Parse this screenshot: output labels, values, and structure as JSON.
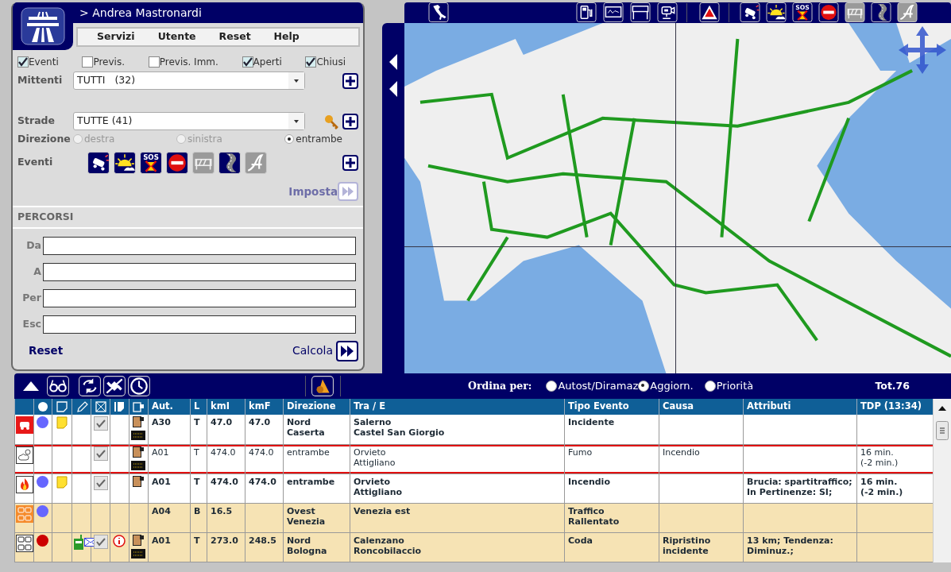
{
  "user": {
    "name": "> Andrea Mastronardi"
  },
  "menu": [
    "Servizi",
    "Utente",
    "Reset",
    "Help"
  ],
  "filters": [
    {
      "label": "Eventi",
      "checked": true
    },
    {
      "label": "Previs.",
      "checked": false
    },
    {
      "label": "Previs. Imm.",
      "checked": false
    },
    {
      "label": "Aperti",
      "checked": true
    },
    {
      "label": "Chiusi",
      "checked": true
    }
  ],
  "senders": {
    "label": "Mittenti",
    "value": "TUTTI   (32)"
  },
  "roads": {
    "label": "Strade",
    "value": "TUTTE (41)"
  },
  "direction": {
    "label": "Direzione",
    "options": [
      {
        "label": "destra",
        "selected": false,
        "disabled": true
      },
      {
        "label": "sinistra",
        "selected": false,
        "disabled": true
      },
      {
        "label": "entrambe",
        "selected": true,
        "disabled": false
      }
    ]
  },
  "event_types": {
    "label": "Eventi",
    "items": [
      {
        "kind": "accident",
        "disabled": false
      },
      {
        "kind": "weather",
        "disabled": false
      },
      {
        "kind": "sos",
        "label": "SOS",
        "disabled": false
      },
      {
        "kind": "noentry",
        "disabled": false
      },
      {
        "kind": "roadworks",
        "disabled": true
      },
      {
        "kind": "road",
        "disabled": false
      },
      {
        "kind": "other",
        "disabled": true
      }
    ]
  },
  "apply_button": {
    "label": "Imposta",
    "disabled": true
  },
  "routes": {
    "title": "PERCORSI",
    "fields": [
      {
        "label": "Da"
      },
      {
        "label": "A"
      },
      {
        "label": "Per"
      },
      {
        "label": "Esc"
      }
    ],
    "reset": "Reset",
    "calculate": "Calcola"
  },
  "map_toolbar": {
    "tools": [
      {
        "kind": "italy"
      },
      {
        "kind": "fuel"
      },
      {
        "kind": "sign"
      },
      {
        "kind": "gantry"
      },
      {
        "kind": "camera"
      },
      {
        "kind": "warning"
      }
    ],
    "event_types": [
      {
        "kind": "accident",
        "disabled": false
      },
      {
        "kind": "weather",
        "disabled": false
      },
      {
        "kind": "sos",
        "label": "SOS",
        "disabled": false
      },
      {
        "kind": "noentry",
        "disabled": false
      },
      {
        "kind": "roadworks",
        "disabled": true
      },
      {
        "kind": "road",
        "disabled": false
      },
      {
        "kind": "other",
        "disabled": true
      }
    ]
  },
  "map": {
    "kind": "picture"
  },
  "list_toolbar": {
    "sort_label": "Ordina per:",
    "sort_options": [
      {
        "label": "Autost/Diramaz",
        "selected": false
      },
      {
        "label": "Aggiorn.",
        "selected": true
      },
      {
        "label": "Priorità",
        "selected": false
      }
    ],
    "total": "Tot.76"
  },
  "table": {
    "columns": [
      {
        "kind": "event"
      },
      {
        "kind": "dot"
      },
      {
        "kind": "note"
      },
      {
        "kind": "pencil"
      },
      {
        "kind": "check"
      },
      {
        "kind": "doc"
      },
      {
        "kind": "display"
      },
      {
        "kind": "text",
        "label": "Aut."
      },
      {
        "kind": "text",
        "label": "L"
      },
      {
        "kind": "text",
        "label": "kmI"
      },
      {
        "kind": "text",
        "label": "kmF"
      },
      {
        "kind": "text",
        "label": "Direzione"
      },
      {
        "kind": "text",
        "label": "Tra / E"
      },
      {
        "kind": "text",
        "label": "Tipo Evento"
      },
      {
        "kind": "text",
        "label": "Causa"
      },
      {
        "kind": "text",
        "label": "Attributi"
      },
      {
        "kind": "text",
        "label": "TDP (13:34)"
      }
    ],
    "rows": [
      {
        "kind": "accident",
        "color": "#6666ff",
        "note": true,
        "confirmed": true,
        "doc": true,
        "display": true,
        "road": "A30",
        "lane": "T",
        "km_start": "47.0",
        "km_end": "47.0",
        "direction": "Nord\nCaserta",
        "stretch": "Salerno\nCastel San Giorgio",
        "type": "Incidente",
        "bold": true,
        "highlighted": false,
        "selected": false
      },
      {
        "kind": "smoke",
        "confirmed": true,
        "doc": true,
        "display": true,
        "road": "A01",
        "lane": "T",
        "km_start": "474.0",
        "km_end": "474.0",
        "direction": "entrambe",
        "stretch": "Orvieto\nAttigliano",
        "type": "Fumo",
        "cause": "Incendio",
        "tdp": "16 min.\n(-2 min.)",
        "bold": false,
        "highlighted": false,
        "selected": true
      },
      {
        "kind": "fire",
        "color": "#6666ff",
        "note": true,
        "confirmed": true,
        "doc": true,
        "road": "A01",
        "lane": "T",
        "km_start": "474.0",
        "km_end": "474.0",
        "direction": "entrambe",
        "stretch": "Orvieto\nAttigliano",
        "type": "Incendio",
        "attributes": "Brucia: spartitraffico;\nIn Pertinenze: SI;",
        "tdp": "16 min.\n(-2 min.)",
        "bold": true,
        "highlighted": false,
        "selected": false
      },
      {
        "kind": "traffic",
        "color": "#6666ff",
        "road": "A04",
        "lane": "B",
        "km_start": "16.5",
        "direction": "Ovest\nVenezia",
        "stretch": "Venezia est",
        "type": "Traffico\nRallentato",
        "bold": true,
        "highlighted": true,
        "selected": false
      },
      {
        "kind": "queue",
        "color": "#cc0000",
        "phone": true,
        "mail": true,
        "confirmed": true,
        "info": true,
        "doc": true,
        "display": true,
        "road": "A01",
        "lane": "T",
        "km_start": "273.0",
        "km_end": "248.5",
        "direction": "Nord\nBologna",
        "stretch": "Calenzano\nRoncobilaccio",
        "type": "Coda",
        "cause": "Ripristino\nincidente",
        "attributes": "13 km; Tendenza:\nDiminuz.;",
        "bold": true,
        "highlighted": true,
        "selected": false
      }
    ]
  }
}
